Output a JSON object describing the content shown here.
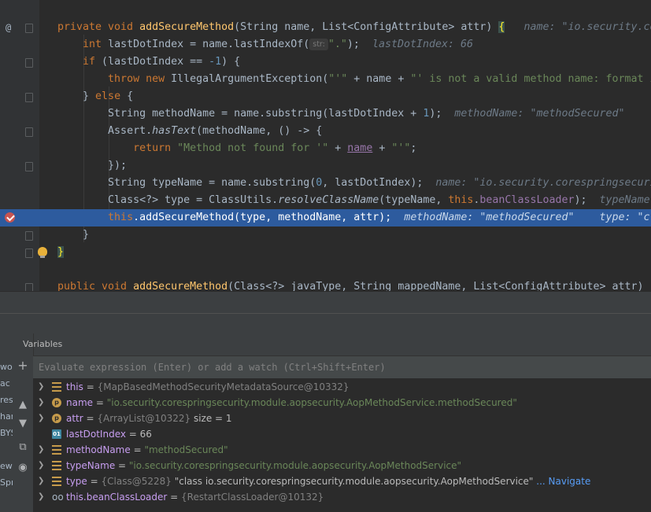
{
  "editor": {
    "lines": [
      {
        "id": "sig"
      },
      {
        "id": "dot"
      },
      {
        "id": "if"
      },
      {
        "id": "throw"
      },
      {
        "id": "else"
      },
      {
        "id": "mname"
      },
      {
        "id": "assert"
      },
      {
        "id": "return"
      },
      {
        "id": "close1"
      },
      {
        "id": "tname"
      },
      {
        "id": "clazz"
      },
      {
        "id": "call"
      },
      {
        "id": "close2"
      },
      {
        "id": "close3"
      }
    ],
    "code": {
      "sig_pre": "private void ",
      "sig_fn": "addSecureMethod",
      "sig_post": "(String name, List<ConfigAttribute> attr) ",
      "sig_brace": "{",
      "sig_hint": "name: \"io.security.co",
      "dot_pre": "int",
      "dot_mid": " lastDotIndex = name.lastIndexOf(",
      "dot_param_hint": "str:",
      "dot_str": "\".\"",
      "dot_end": ");",
      "dot_hint": "lastDotIndex: 66",
      "if_kw": "if",
      "if_mid": " (lastDotIndex == ",
      "if_num": "-1",
      "if_end": ") {",
      "throw_kw": "throw new",
      "throw_mid": " IllegalArgumentException(",
      "throw_str1": "\"'\"",
      "throw_plus": " + name + ",
      "throw_str2": "\"' is not a valid method name: format i",
      "else_pre": "} ",
      "else_kw": "else",
      "else_post": " {",
      "mname_pre": "String methodName = name.substring(lastDotIndex + ",
      "mname_num": "1",
      "mname_end": ");",
      "mname_hint": "methodName: \"methodSecured\"",
      "assert_pre": "Assert.",
      "assert_fn": "hasText",
      "assert_post": "(methodName, () -> {",
      "return_kw": "return",
      "return_str1": " \"Method not found for '\"",
      "return_plus1": " + ",
      "return_name": "name",
      "return_plus2": " + ",
      "return_str2": "\"'\"",
      "return_end": ";",
      "close1": "});",
      "tname_pre": "String typeName = name.substring(",
      "tname_num": "0",
      "tname_end": ", lastDotIndex);",
      "tname_hint": "name: \"io.security.corespringsecuri",
      "clazz_pre": "Class<?> type = ClassUtils.",
      "clazz_fn": "resolveClassName",
      "clazz_mid": "(typeName, ",
      "clazz_this": "this",
      "clazz_dot": ".",
      "clazz_field": "beanClassLoader",
      "clazz_end": ");",
      "clazz_hint": "typeName",
      "call_this": "this",
      "call_rest": ".addSecureMethod(type, methodName, attr);",
      "call_hint1": "methodName: \"methodSecured\"",
      "call_hint2": "type: \"c",
      "close2": "}",
      "close3": "}",
      "next_pre": "public void ",
      "next_fn": "addSecureMethod",
      "next_post": "(Class<?> javaType, String mappedName, List<ConfigAttribute> attr)"
    }
  },
  "debugger": {
    "panel_title": "Variables",
    "left_fragments": [
      "wo",
      "ac",
      "res",
      "har",
      "BYS",
      "ew",
      "Spr"
    ],
    "eval_placeholder": "Evaluate expression (Enter) or add a watch (Ctrl+Shift+Enter)",
    "variables": [
      {
        "icon": "field",
        "expandable": true,
        "name": "this",
        "eq": " = ",
        "value": "{MapBasedMethodSecurityMetadataSource@10332}",
        "kind": "obj",
        "extra": ""
      },
      {
        "icon": "param",
        "expandable": true,
        "name": "name",
        "eq": " = ",
        "value": "\"io.security.corespringsecurity.module.aopsecurity.AopMethodService.methodSecured\"",
        "kind": "str",
        "extra": ""
      },
      {
        "icon": "param",
        "expandable": true,
        "name": "attr",
        "eq": " = ",
        "value": "{ArrayList@10322}",
        "kind": "obj",
        "extra": "  size = 1"
      },
      {
        "icon": "local",
        "expandable": false,
        "name": "lastDotIndex",
        "eq": " = ",
        "value": "66",
        "kind": "num",
        "extra": ""
      },
      {
        "icon": "field",
        "expandable": true,
        "name": "methodName",
        "eq": " = ",
        "value": "\"methodSecured\"",
        "kind": "str",
        "extra": ""
      },
      {
        "icon": "field",
        "expandable": true,
        "name": "typeName",
        "eq": " = ",
        "value": "\"io.security.corespringsecurity.module.aopsecurity.AopMethodService\"",
        "kind": "str",
        "extra": ""
      },
      {
        "icon": "field",
        "expandable": true,
        "name": "type",
        "eq": " = ",
        "value": "{Class@5228}",
        "kind": "obj",
        "extra": " \"class io.security.corespringsecurity.module.aopsecurity.AopMethodService\"",
        "link": "... Navigate"
      },
      {
        "icon": "watch",
        "expandable": true,
        "name": "this.beanClassLoader",
        "eq": " = ",
        "value": "{RestartClassLoader@10132}",
        "kind": "obj",
        "extra": ""
      }
    ],
    "tool_icons": [
      "add-watch-icon",
      "up-arrow-icon",
      "down-arrow-icon",
      "copy-icon",
      "glasses-icon"
    ],
    "colors": {
      "exec_line": "#2d5b9e",
      "breakpoint": "#c75450",
      "bulb": "#e8b13a"
    }
  }
}
